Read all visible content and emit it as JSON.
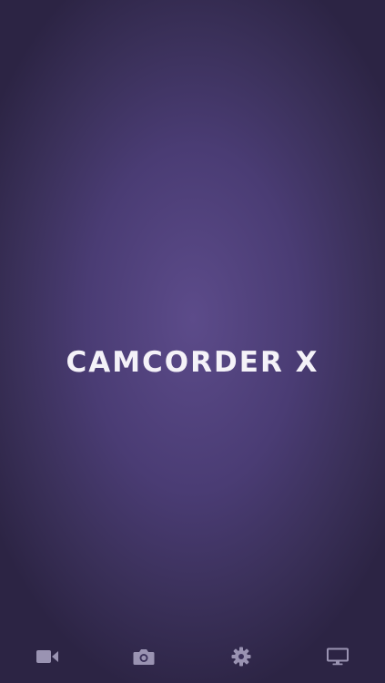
{
  "splash": {
    "title": "CAMCORDER X"
  },
  "tabbar": {
    "items": [
      {
        "icon": "video-camera-icon"
      },
      {
        "icon": "photo-camera-icon"
      },
      {
        "icon": "gear-icon"
      },
      {
        "icon": "monitor-icon"
      }
    ]
  },
  "colors": {
    "background_center": "#5c4b8a",
    "background_edge": "#2c2444",
    "title": "#f4f2f8",
    "icon": "#9a93b2"
  }
}
